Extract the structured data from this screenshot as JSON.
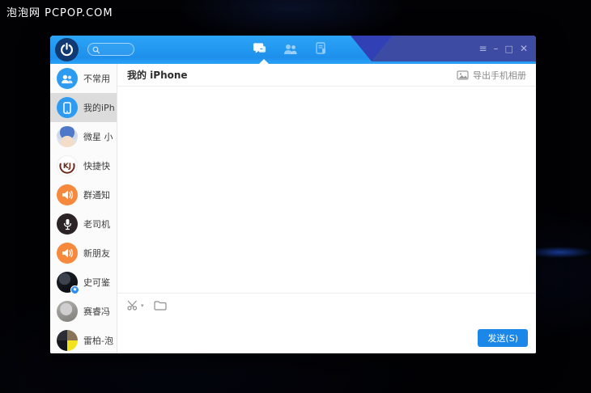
{
  "watermark": "泡泡网 PCPOP.COM",
  "window": {
    "titlebar": {
      "search_placeholder": "",
      "tabs": [
        {
          "name": "messages",
          "active": true
        },
        {
          "name": "contacts",
          "active": false
        },
        {
          "name": "files",
          "active": false
        }
      ],
      "controls": {
        "menu": "≡",
        "minimize": "–",
        "maximize": "□",
        "close": "✕"
      }
    },
    "sidebar": {
      "items": [
        {
          "label": "不常用",
          "icon": "group-blue"
        },
        {
          "label": "我的iPh",
          "icon": "phone-blue",
          "selected": true
        },
        {
          "label": "微星 小",
          "icon": "msi-mascot-avatar"
        },
        {
          "label": "快捷快",
          "icon": "kj-logo-avatar"
        },
        {
          "label": "群通知",
          "icon": "speaker-orange"
        },
        {
          "label": "老司机",
          "icon": "mic-dark-avatar"
        },
        {
          "label": "新朋友",
          "icon": "speaker-orange"
        },
        {
          "label": "史可鉴",
          "icon": "cat-avatar-star-badge",
          "badge": "★"
        },
        {
          "label": "赛睿冯",
          "icon": "dog-avatar"
        },
        {
          "label": "雷柏-泡",
          "icon": "quad-color-avatar"
        }
      ]
    },
    "main": {
      "title": "我的 iPhone",
      "export_label": "导出手机相册",
      "send_label": "发送(S)"
    }
  },
  "colors": {
    "titlebar_blue": "#1E96F0",
    "titlebar_indigo": "#3D4BA3",
    "accent_blue": "#1B87E9",
    "selected_item_gray": "#DCDCDC",
    "avatar_orange": "#F6893D",
    "avatar_blue": "#2D9CF0"
  }
}
